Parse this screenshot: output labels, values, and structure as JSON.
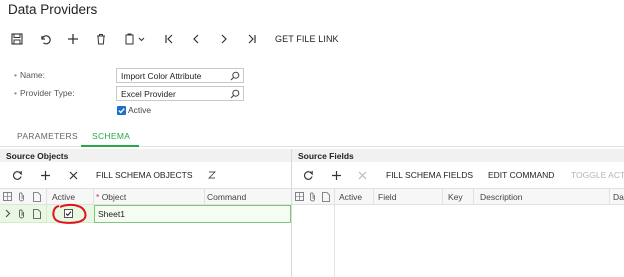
{
  "window": {
    "title": "Data Providers"
  },
  "toolbar": {
    "icons": [
      "save-icon",
      "undo-icon",
      "add-icon",
      "delete-icon",
      "copy-paste-icon",
      "first-record-icon",
      "previous-record-icon",
      "next-record-icon",
      "last-record-icon"
    ],
    "get_file_link_label": "GET FILE LINK"
  },
  "form": {
    "name_label": "Name:",
    "name_value": "Import Color Attribute",
    "provider_type_label": "Provider Type:",
    "provider_type_value": "Excel Provider",
    "active_label": "Active",
    "active_checked": true
  },
  "tabs": [
    {
      "label": "PARAMETERS",
      "active": false
    },
    {
      "label": "SCHEMA",
      "active": true
    }
  ],
  "source_objects": {
    "title": "Source Objects",
    "toolbar": {
      "refresh": "refresh-icon",
      "add": "add-icon",
      "delete": "delete-icon",
      "fill_label": "FILL SCHEMA OBJECTS",
      "fit_icon": "fit-columns-icon"
    },
    "columns": [
      "Active",
      "Object",
      "Command"
    ],
    "rows": [
      {
        "active": true,
        "object": "Sheet1",
        "command": ""
      }
    ]
  },
  "source_fields": {
    "title": "Source Fields",
    "toolbar": {
      "fill_label": "FILL SCHEMA FIELDS",
      "edit_label": "EDIT COMMAND",
      "toggle_label": "TOGGLE ACT"
    },
    "columns": [
      "Active",
      "Field",
      "Key",
      "Description",
      "Da"
    ]
  },
  "colors": {
    "accent_green": "#2aa845",
    "checkbox_blue": "#1f6fc5",
    "annotation_red": "#e0141b"
  }
}
